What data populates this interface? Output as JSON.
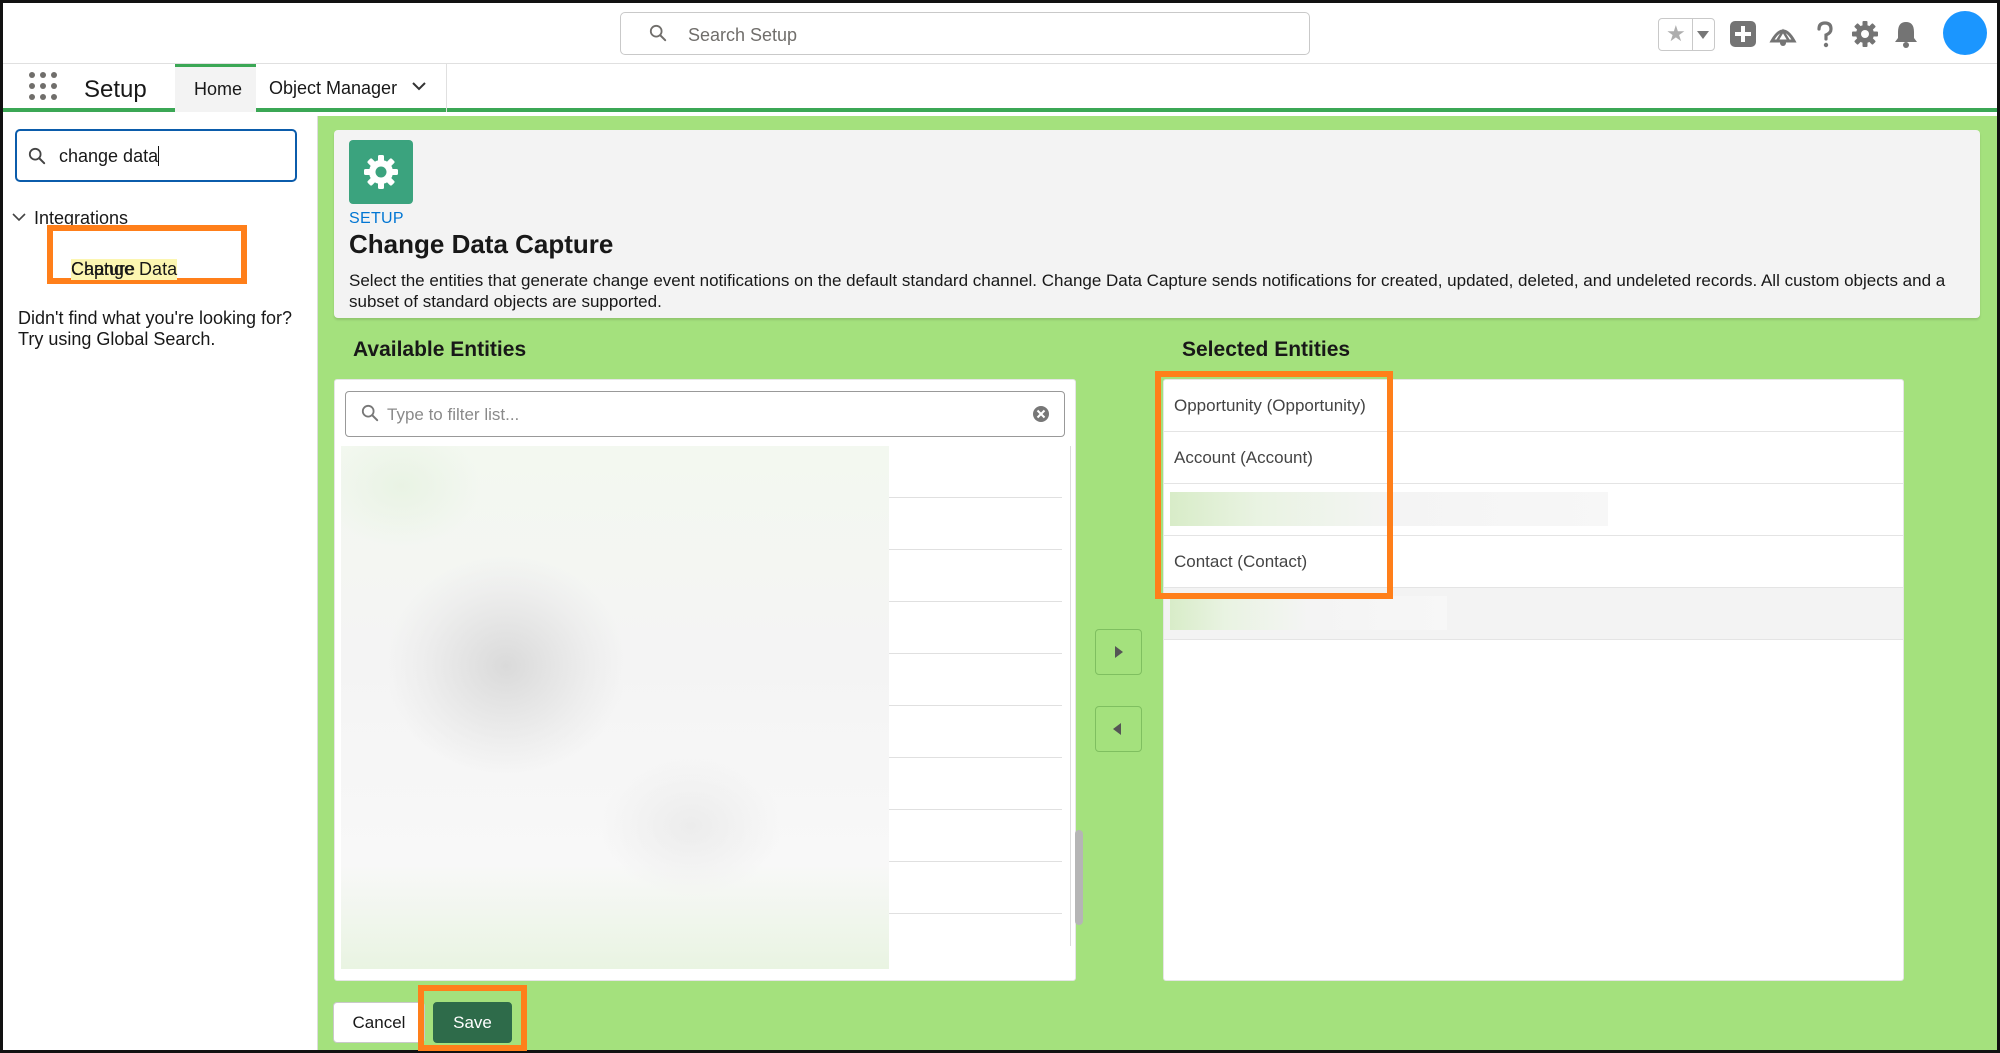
{
  "header": {
    "search_placeholder": "Search Setup"
  },
  "nav": {
    "app_name": "Setup",
    "tabs": [
      {
        "label": "Home"
      },
      {
        "label": "Object Manager"
      }
    ]
  },
  "sidebar": {
    "quick_find_value": "change data",
    "group_label": "Integrations",
    "result_highlight": "Change Data",
    "result_rest": " Capture",
    "not_found_line1": "Didn't find what you're looking for?",
    "not_found_line2": "Try using Global Search."
  },
  "page": {
    "eyebrow": "SETUP",
    "title": "Change Data Capture",
    "description": "Select the entities that generate change event notifications on the default standard channel. Change Data Capture sends notifications for created, updated, deleted, and undeleted records. All custom objects and a subset of standard objects are supported."
  },
  "available": {
    "title": "Available Entities",
    "filter_placeholder": "Type to filter list..."
  },
  "selected": {
    "title": "Selected Entities",
    "items": [
      {
        "label": "Opportunity (Opportunity)"
      },
      {
        "label": "Account (Account)"
      },
      {
        "label": ""
      },
      {
        "label": "Contact (Contact)"
      },
      {
        "label": ""
      }
    ]
  },
  "actions": {
    "cancel_label": "Cancel",
    "save_label": "Save"
  },
  "colors": {
    "accent": "#3ba755",
    "highlight_box": "#ff7f1a",
    "avatar": "#1b96ff",
    "save_button": "#2e6b4a",
    "main_background": "#a4e17d"
  }
}
